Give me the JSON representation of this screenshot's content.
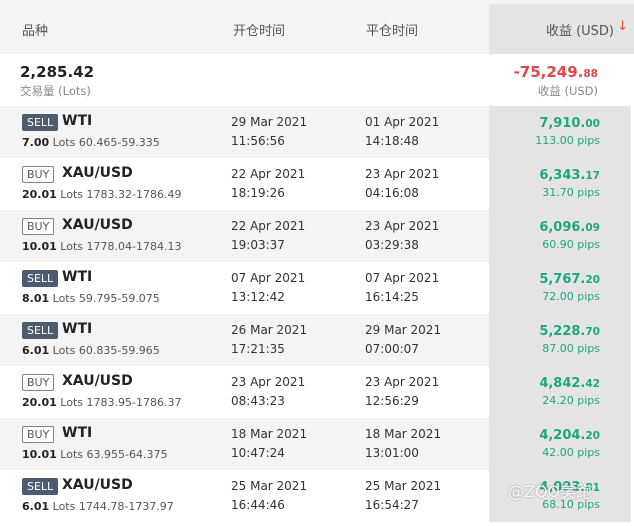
{
  "header": {
    "product": "品种",
    "open_time": "开仓时间",
    "close_time": "平仓时间",
    "profit": "收益 (USD)",
    "sort_icon": "arrow-down-icon",
    "sort_glyph": "↓"
  },
  "summary": {
    "lots": "2,285.42",
    "lots_label": "交易量 (Lots)",
    "profit_main": "-75,249.",
    "profit_dec": "88",
    "profit_label": "收益 (USD)"
  },
  "trades": [
    {
      "side": "SELL",
      "symbol": "WTI",
      "lots": "7.00",
      "lots_unit": "Lots",
      "price_range": "60.465-59.335",
      "open_date": "29 Mar 2021",
      "open_time": "11:56:56",
      "close_date": "01 Apr 2021",
      "close_time": "14:18:48",
      "profit_main": "7,910.",
      "profit_dec": "00",
      "pips": "113.00 pips"
    },
    {
      "side": "BUY",
      "symbol": "XAU/USD",
      "lots": "20.01",
      "lots_unit": "Lots",
      "price_range": "1783.32-1786.49",
      "open_date": "22 Apr 2021",
      "open_time": "18:19:26",
      "close_date": "23 Apr 2021",
      "close_time": "04:16:08",
      "profit_main": "6,343.",
      "profit_dec": "17",
      "pips": "31.70 pips"
    },
    {
      "side": "BUY",
      "symbol": "XAU/USD",
      "lots": "10.01",
      "lots_unit": "Lots",
      "price_range": "1778.04-1784.13",
      "open_date": "22 Apr 2021",
      "open_time": "19:03:37",
      "close_date": "23 Apr 2021",
      "close_time": "03:29:38",
      "profit_main": "6,096.",
      "profit_dec": "09",
      "pips": "60.90 pips"
    },
    {
      "side": "SELL",
      "symbol": "WTI",
      "lots": "8.01",
      "lots_unit": "Lots",
      "price_range": "59.795-59.075",
      "open_date": "07 Apr 2021",
      "open_time": "13:12:42",
      "close_date": "07 Apr 2021",
      "close_time": "16:14:25",
      "profit_main": "5,767.",
      "profit_dec": "20",
      "pips": "72.00 pips"
    },
    {
      "side": "SELL",
      "symbol": "WTI",
      "lots": "6.01",
      "lots_unit": "Lots",
      "price_range": "60.835-59.965",
      "open_date": "26 Mar 2021",
      "open_time": "17:21:35",
      "close_date": "29 Mar 2021",
      "close_time": "07:00:07",
      "profit_main": "5,228.",
      "profit_dec": "70",
      "pips": "87.00 pips"
    },
    {
      "side": "BUY",
      "symbol": "XAU/USD",
      "lots": "20.01",
      "lots_unit": "Lots",
      "price_range": "1783.95-1786.37",
      "open_date": "23 Apr 2021",
      "open_time": "08:43:23",
      "close_date": "23 Apr 2021",
      "close_time": "12:56:29",
      "profit_main": "4,842.",
      "profit_dec": "42",
      "pips": "24.20 pips"
    },
    {
      "side": "BUY",
      "symbol": "WTI",
      "lots": "10.01",
      "lots_unit": "Lots",
      "price_range": "63.955-64.375",
      "open_date": "18 Mar 2021",
      "open_time": "10:47:24",
      "close_date": "18 Mar 2021",
      "close_time": "13:01:00",
      "profit_main": "4,204.",
      "profit_dec": "20",
      "pips": "42.00 pips"
    },
    {
      "side": "SELL",
      "symbol": "XAU/USD",
      "lots": "6.01",
      "lots_unit": "Lots",
      "price_range": "1744.78-1737.97",
      "open_date": "25 Mar 2021",
      "open_time": "16:44:46",
      "close_date": "25 Mar 2021",
      "close_time": "16:54:27",
      "profit_main": "4,093.",
      "profit_dec": "81",
      "pips": "68.10 pips"
    }
  ],
  "watermark": "@ZQQ美跑",
  "colors": {
    "profit_positive": "#1ea683",
    "profit_negative": "#e0474c",
    "sort_arrow": "#e8542a",
    "badge": "#4e5a6e"
  }
}
